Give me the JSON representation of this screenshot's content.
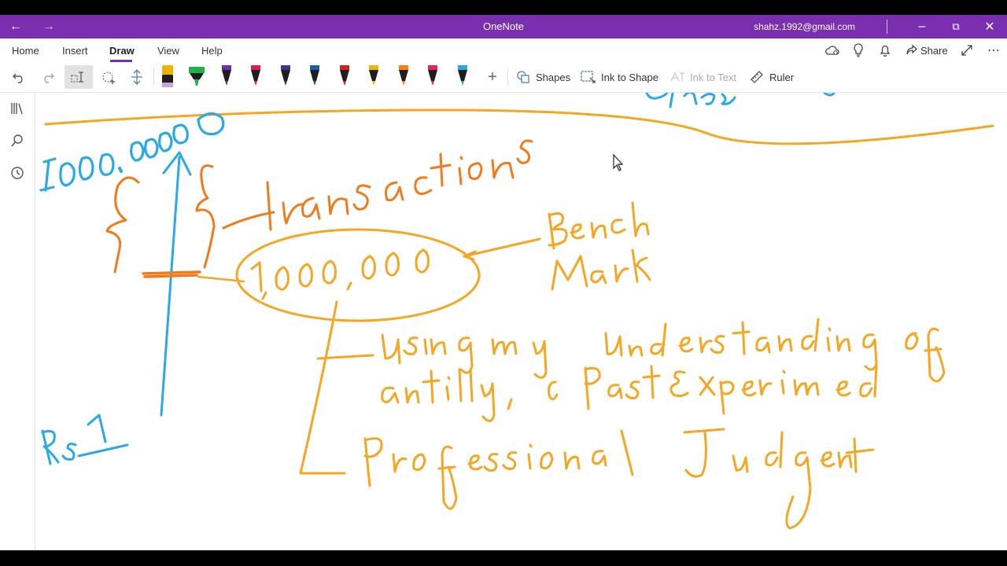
{
  "titlebar": {
    "app_title": "OneNote",
    "account_email": "shahz.1992@gmail.com",
    "back_icon": "back-arrow-icon",
    "forward_icon": "forward-arrow-icon"
  },
  "menu": {
    "tabs": [
      "Home",
      "Insert",
      "Draw",
      "View",
      "Help"
    ],
    "active_tab": "Draw",
    "share_label": "Share"
  },
  "toolbar": {
    "pen_colors": [
      "#1e1e1e",
      "#22b14c",
      "#6f2da8",
      "#e6194b",
      "#4b2f8c",
      "#1f5fa8",
      "#d62020",
      "#f0b400",
      "#ff7f0e",
      "#e8244f",
      "#29a8e0"
    ],
    "shapes_label": "Shapes",
    "ink_to_shape_label": "Ink to Shape",
    "ink_to_text_label": "Ink to Text",
    "ruler_label": "Ruler"
  },
  "colors": {
    "accent": "#7a2fb0",
    "ink_orange": "#f5a623",
    "ink_dark_orange": "#f07b1d",
    "ink_blue": "#2aa8e8"
  }
}
